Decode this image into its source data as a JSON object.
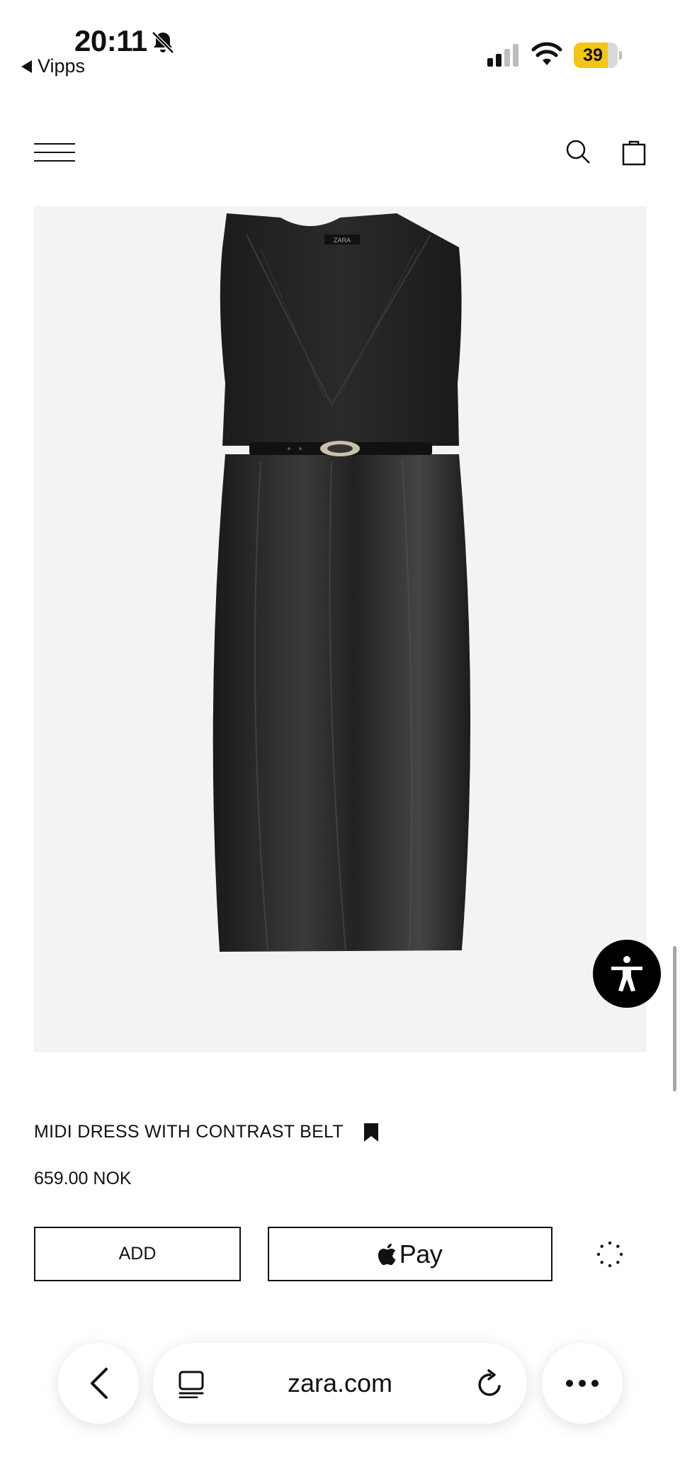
{
  "status_bar": {
    "time": "20:11",
    "back_app": "Vipps",
    "battery": "39"
  },
  "header": {
    "menu_icon": "hamburger-icon",
    "search_icon": "search-icon",
    "bag_icon": "shopping-bag-icon"
  },
  "product": {
    "name": "MIDI DRESS WITH CONTRAST BELT",
    "price": "659.00 NOK",
    "image_label": "ZARA"
  },
  "actions": {
    "add_label": "ADD",
    "apple_pay_label": "Pay"
  },
  "browser": {
    "url": "zara.com"
  },
  "colors": {
    "background": "#ffffff",
    "image_bg": "#f3f3f5",
    "text": "#111111",
    "battery": "#f3c614"
  }
}
